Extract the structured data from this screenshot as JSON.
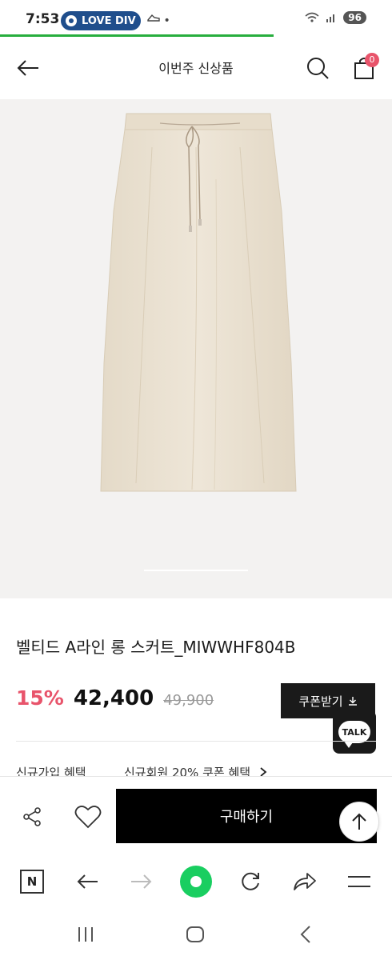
{
  "status_bar": {
    "time": "7:53",
    "notification_pill": "LOVE DIV",
    "extra_dot": "•",
    "battery": "96"
  },
  "header": {
    "title": "이번주 신상품",
    "cart_count": "0"
  },
  "product": {
    "name": "벨티드 A라인 롱 스커트_MIWWHF804B",
    "discount": "15%",
    "price": "42,400",
    "original_price": "49,900",
    "coupon_label": "쿠폰받기",
    "talk_label": "TALK",
    "benefit_label": "신규가입 혜택",
    "benefit_value": "신규회원 20% 쿠폰 혜택"
  },
  "actions": {
    "buy_label": "구매하기"
  },
  "colors": {
    "accent_pink": "#e8546b",
    "progress_green": "#27ae3e",
    "naver_green": "#19ce60",
    "skirt": "#ece3d3"
  }
}
